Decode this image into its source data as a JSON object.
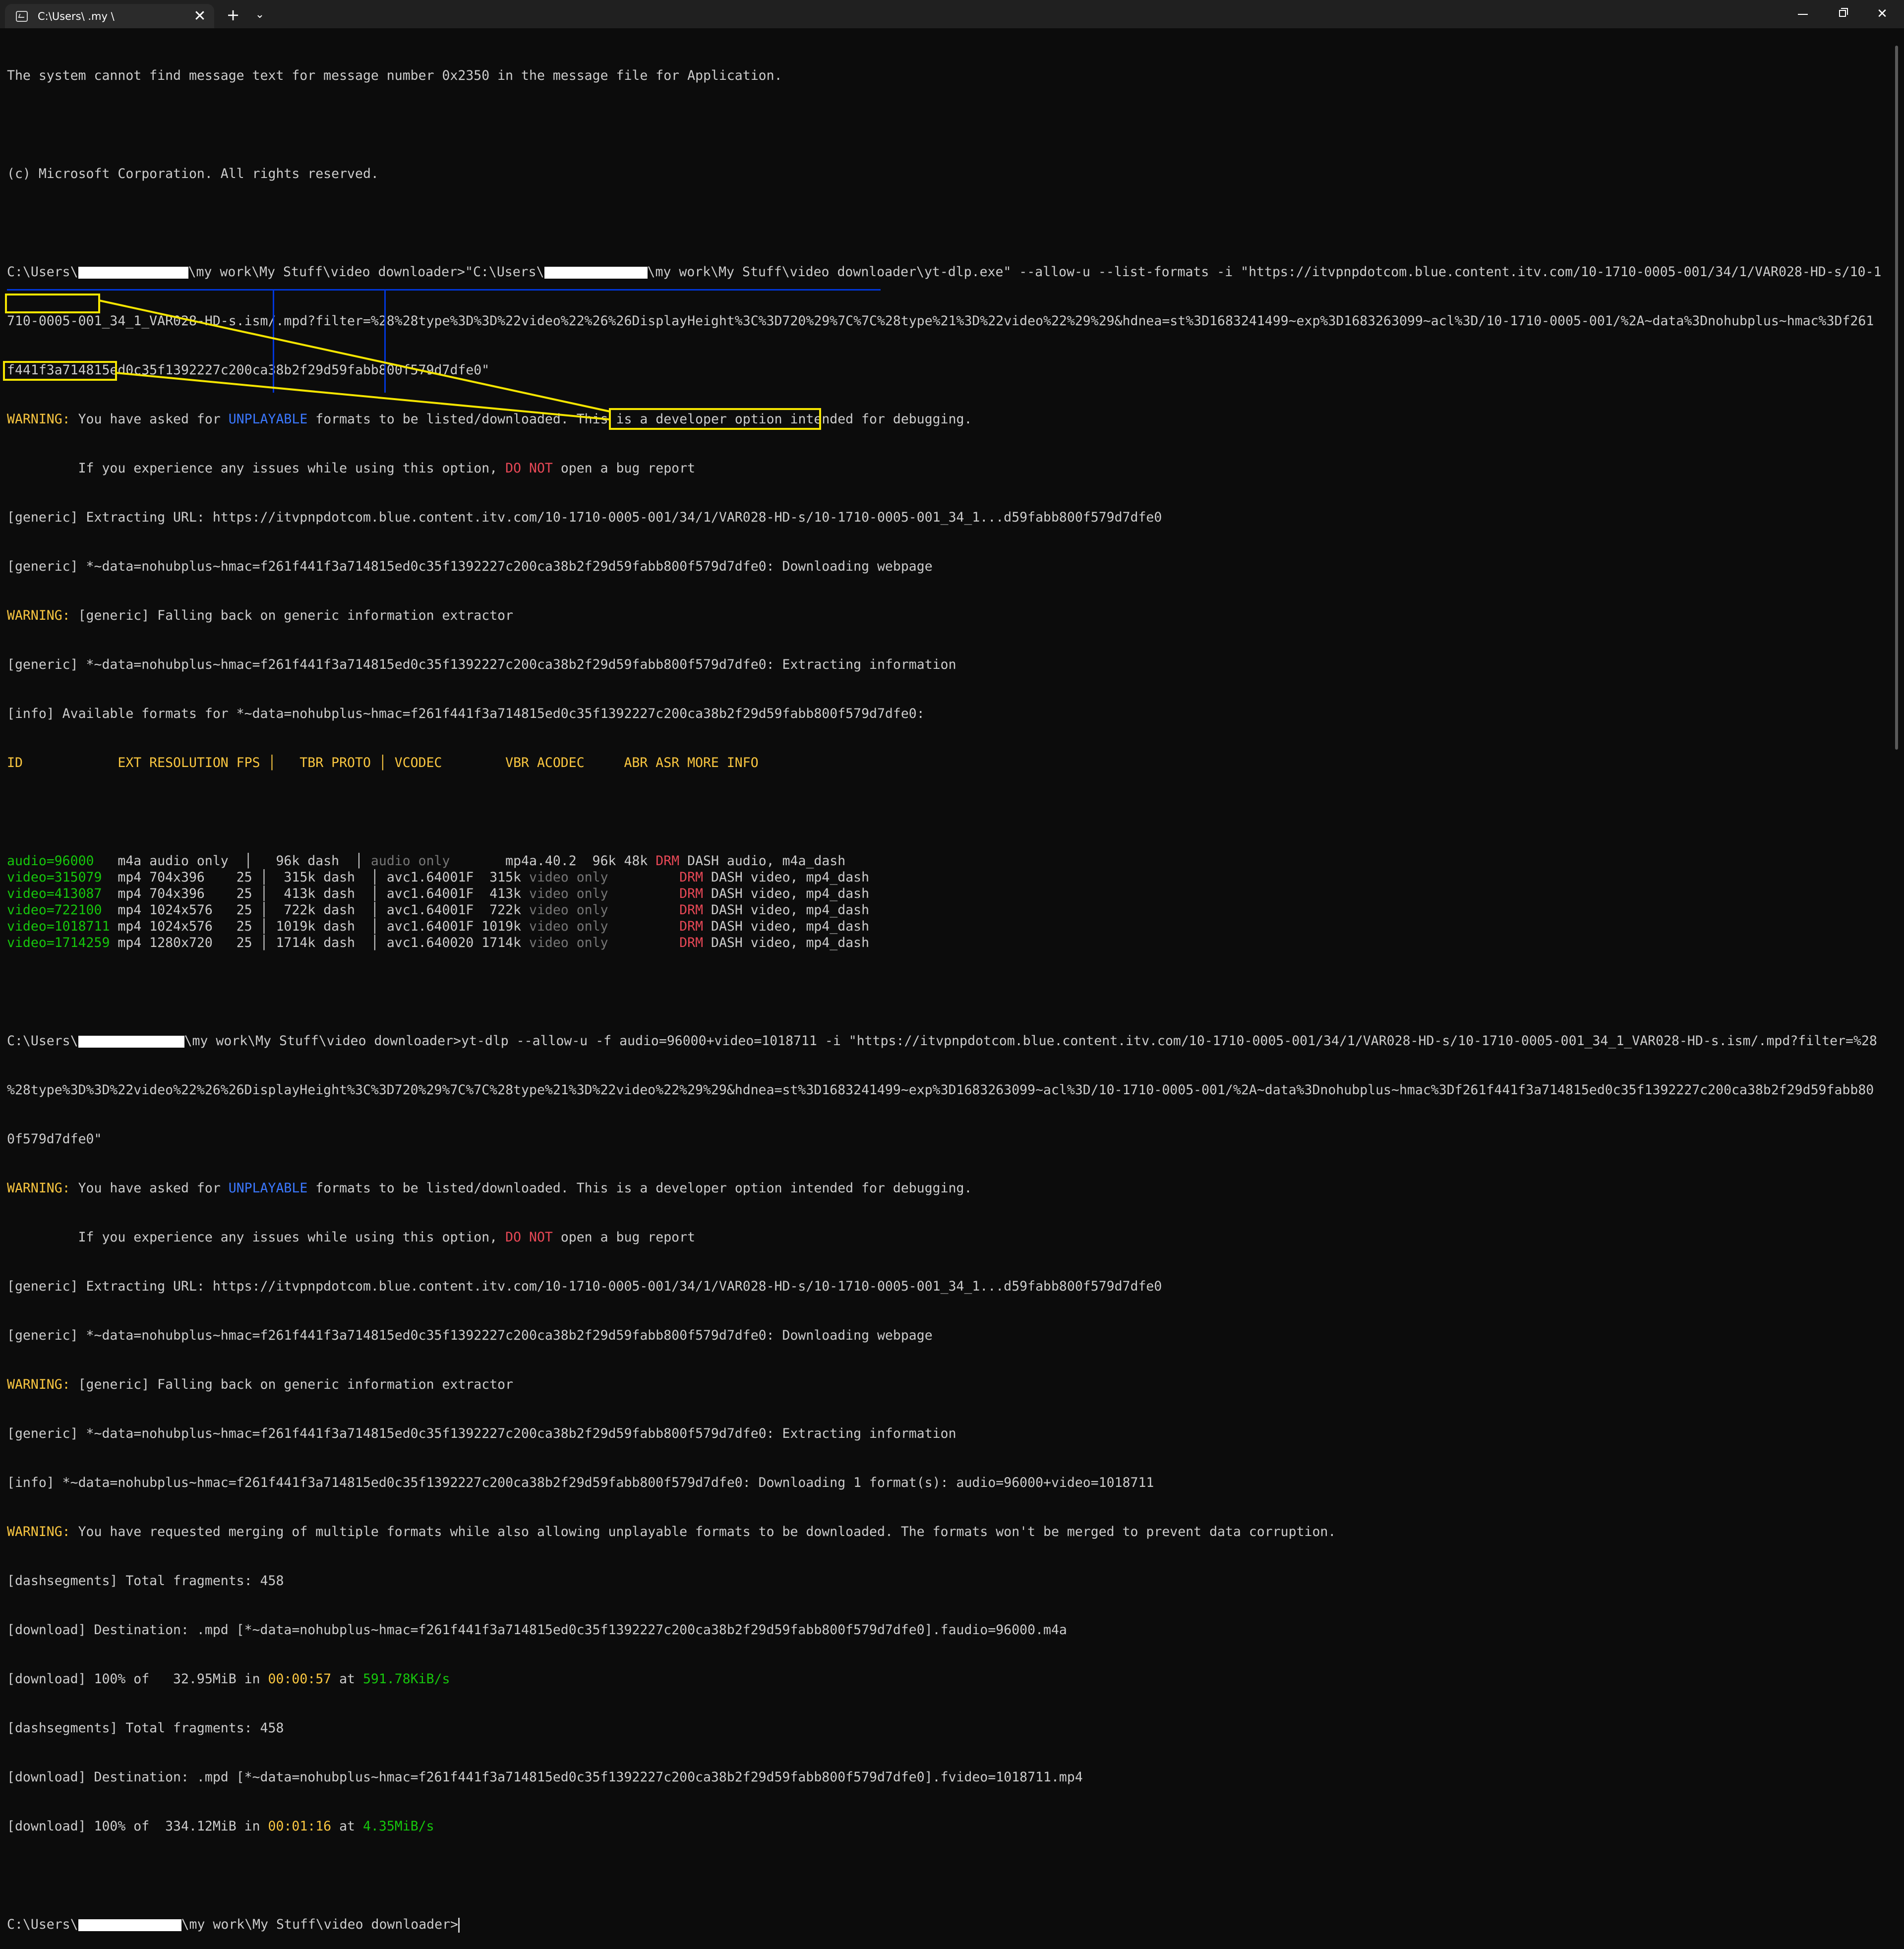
{
  "window": {
    "tab_title": "C:\\Users\\ .my \\",
    "close_glyph": "✕",
    "new_tab_glyph": "+",
    "dropdown_glyph": "⌄",
    "close_window_glyph": "✕"
  },
  "terminal": {
    "l01": "The system cannot find message text for message number 0x2350 in the message file for Application.",
    "l02": "(c) Microsoft Corporation. All rights reserved.",
    "cmd1_prefix": "C:\\Users\\",
    "cmd1_mid": "\\my work\\My Stuff\\video downloader>\"C:\\Users\\",
    "cmd1_rest": "\\my work\\My Stuff\\video downloader\\yt-dlp.exe\" --allow-u --list-formats -i \"https://itvpnpdotcom.blue.content.itv.com/10-1710-0005-001/34/1/VAR028-HD-s/10-1",
    "cmd1_l2": "710-0005-001_34_1_VAR028-HD-s.ism/.mpd?filter=%28%28type%3D%3D%22video%22%26%26DisplayHeight%3C%3D720%29%7C%7C%28type%21%3D%22video%22%29%29&hdnea=st%3D1683241499~exp%3D1683263099~acl%3D/10-1710-0005-001/%2A~data%3Dnohubplus~hmac%3Df261",
    "cmd1_l3": "f441f3a714815ed0c35f1392227c200ca38b2f29d59fabb800f579d7dfe0\"",
    "warn_label": "WARNING:",
    "warn1_a": " You have asked for ",
    "warn1_unplayable": "UNPLAYABLE",
    "warn1_b": " formats to be listed/downloaded. This is a developer option intended for debugging.",
    "warn2_a": "         If you experience any issues while using this option, ",
    "warn2_donot": "DO NOT",
    "warn2_b": " open a bug report",
    "gen1": "[generic] Extracting URL: https://itvpnpdotcom.blue.content.itv.com/10-1710-0005-001/34/1/VAR028-HD-s/10-1710-0005-001_34_1...d59fabb800f579d7dfe0",
    "gen2": "[generic] *~data=nohubplus~hmac=f261f441f3a714815ed0c35f1392227c200ca38b2f29d59fabb800f579d7dfe0: Downloading webpage",
    "gen3_rest": " [generic] Falling back on generic information extractor",
    "gen4": "[generic] *~data=nohubplus~hmac=f261f441f3a714815ed0c35f1392227c200ca38b2f29d59fabb800f579d7dfe0: Extracting information",
    "info1": "[info] Available formats for *~data=nohubplus~hmac=f261f441f3a714815ed0c35f1392227c200ca38b2f29d59fabb800f579d7dfe0:",
    "table_header": "ID            EXT RESOLUTION FPS │   TBR PROTO │ VCODEC        VBR ACODEC     ABR ASR MORE INFO",
    "rows": [
      {
        "id": "audio=96000  ",
        "a": " m4a audio only  │   96k dash  │ ",
        "codec_gy": "audio only",
        "b": "       mp4a.40.2  96k 48k ",
        "drm": "DRM",
        "c": " DASH audio, m4a_dash"
      },
      {
        "id": "video=315079 ",
        "a": " mp4 704x396    25 │  315k dash  │ avc1.64001F  315k ",
        "codec_gy": "video only",
        "b": "         ",
        "drm": "DRM",
        "c": " DASH video, mp4_dash"
      },
      {
        "id": "video=413087 ",
        "a": " mp4 704x396    25 │  413k dash  │ avc1.64001F  413k ",
        "codec_gy": "video only",
        "b": "         ",
        "drm": "DRM",
        "c": " DASH video, mp4_dash"
      },
      {
        "id": "video=722100 ",
        "a": " mp4 1024x576   25 │  722k dash  │ avc1.64001F  722k ",
        "codec_gy": "video only",
        "b": "         ",
        "drm": "DRM",
        "c": " DASH video, mp4_dash"
      },
      {
        "id": "video=1018711",
        "a": " mp4 1024x576   25 │ 1019k dash  │ avc1.64001F 1019k ",
        "codec_gy": "video only",
        "b": "         ",
        "drm": "DRM",
        "c": " DASH video, mp4_dash"
      },
      {
        "id": "video=1714259",
        "a": " mp4 1280x720   25 │ 1714k dash  │ avc1.640020 1714k ",
        "codec_gy": "video only",
        "b": "         ",
        "drm": "DRM",
        "c": " DASH video, mp4_dash"
      }
    ],
    "cmd2_prefix": "C:\\Users\\",
    "cmd2_mid": "\\my work\\My Stuff\\video downloader>yt-dlp --allow-u -f ",
    "cmd2_format": "audio=96000+video=1018711",
    "cmd2_rest": " -i \"https://itvpnpdotcom.blue.content.itv.com/10-1710-0005-001/34/1/VAR028-HD-s/10-1710-0005-001_34_1_VAR028-HD-s.ism/.mpd?filter=%28",
    "cmd2_l2": "%28type%3D%3D%22video%22%26%26DisplayHeight%3C%3D720%29%7C%7C%28type%21%3D%22video%22%29%29&hdnea=st%3D1683241499~exp%3D1683263099~acl%3D/10-1710-0005-001/%2A~data%3Dnohubplus~hmac%3Df261f441f3a714815ed0c35f1392227c200ca38b2f29d59fabb80",
    "cmd2_l3": "0f579d7dfe0\"",
    "info2": "[info] *~data=nohubplus~hmac=f261f441f3a714815ed0c35f1392227c200ca38b2f29d59fabb800f579d7dfe0: Downloading 1 format(s): audio=96000+video=1018711",
    "warn3_rest": " You have requested merging of multiple formats while also allowing unplayable formats to be downloaded. The formats won't be merged to prevent data corruption.",
    "dash1": "[dashsegments] Total fragments: 458",
    "dl1": "[download] Destination: .mpd [*~data=nohubplus~hmac=f261f441f3a714815ed0c35f1392227c200ca38b2f29d59fabb800f579d7dfe0].faudio=96000.m4a",
    "dl2_a": "[download] 100% of   32.95MiB in ",
    "dl2_time": "00:00:57",
    "dl2_b": " at ",
    "dl2_speed": "591.78KiB/s",
    "dash2": "[dashsegments] Total fragments: 458",
    "dl3": "[download] Destination: .mpd [*~data=nohubplus~hmac=f261f441f3a714815ed0c35f1392227c200ca38b2f29d59fabb800f579d7dfe0].fvideo=1018711.mp4",
    "dl4_a": "[download] 100% of  334.12MiB in ",
    "dl4_time": "00:01:16",
    "dl4_b": " at ",
    "dl4_speed": "4.35MiB/s",
    "prompt_prefix": "C:\\Users\\",
    "prompt_rest": "\\my work\\My Stuff\\video downloader>"
  },
  "colors": {
    "background": "#0c0c0c",
    "text": "#cccccc",
    "warning": "#f9c640",
    "highlight_box": "#f5e500",
    "unplayable": "#3b78ff",
    "drm": "#e74856",
    "id_green": "#16c60c"
  }
}
